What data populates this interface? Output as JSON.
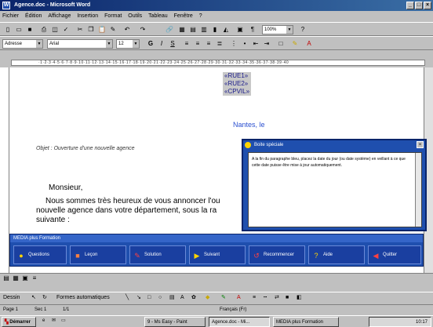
{
  "window": {
    "title": "Agence.doc - Microsoft Word"
  },
  "menu": [
    "Fichier",
    "Édition",
    "Affichage",
    "Insertion",
    "Format",
    "Outils",
    "Tableau",
    "Fenêtre",
    "?"
  ],
  "format_bar": {
    "style": "Adresse",
    "font": "Arial",
    "size": "12"
  },
  "standard_bar": {
    "zoom": "100%"
  },
  "document": {
    "merge_fields": [
      "«RUE1»",
      "«RUE2»",
      "«CPVIL»"
    ],
    "place": "Nantes, le",
    "objet": "Objet : Ouverture d'une nouvelle agence",
    "salutation": "Monsieur,",
    "body_lines": [
      "Nous sommes très heureux de vous annoncer l'ou",
      "nouvelle agence dans votre département, sous la ra",
      "suivante :"
    ]
  },
  "help_panel": {
    "title": "Boite spéciale",
    "text": "A la fin du paragraphe bleu, placez la date du jour (ou date système) en veillant à ce que cette date puisse être mise à jour automatiquement."
  },
  "media_bar": {
    "title": "MEDIA plus Formation",
    "buttons": [
      "Questions",
      "Leçon",
      "Solution",
      "Suivant",
      "Recommencer",
      "Aide",
      "Quitter"
    ]
  },
  "drawing_bar": {
    "dessin": "Dessin",
    "autoformes": "Formes automatiques"
  },
  "status": {
    "page": "Page 1",
    "section": "Sec 1",
    "pos": "1/1",
    "lang": "Français (Fr)"
  },
  "taskbar": {
    "start": "Démarrer",
    "items": [
      "9 - Ms Easy - Paint",
      "Agence.doc - Mi...",
      "MEDIA plus Formation"
    ],
    "clock": "10:17"
  }
}
